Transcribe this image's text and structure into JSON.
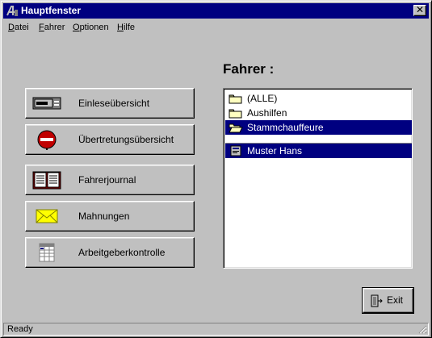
{
  "window": {
    "title": "Hauptfenster",
    "close_glyph": "✕"
  },
  "menu": [
    {
      "label": "Datei",
      "accel": "D",
      "rest": "atei"
    },
    {
      "label": "Fahrer",
      "accel": "F",
      "rest": "ahrer"
    },
    {
      "label": "Optionen",
      "accel": "O",
      "rest": "ptionen"
    },
    {
      "label": "Hilfe",
      "accel": "H",
      "rest": "ilfe"
    }
  ],
  "actions": [
    {
      "label": "Einleseübersicht",
      "icon": "card-reader-icon"
    },
    {
      "label": "Übertretungsübersicht",
      "icon": "no-entry-icon"
    },
    {
      "label": "Fahrerjournal",
      "icon": "open-book-icon"
    },
    {
      "label": "Mahnungen",
      "icon": "envelope-icon"
    },
    {
      "label": "Arbeitgeberkontrolle",
      "icon": "spreadsheet-icon"
    }
  ],
  "drivers": {
    "heading": "Fahrer :",
    "groups": [
      {
        "label": "(ALLE)",
        "icon": "folder-icon",
        "selected": false
      },
      {
        "label": "Aushilfen",
        "icon": "folder-icon",
        "selected": false
      },
      {
        "label": "Stammchauffeure",
        "icon": "open-folder-icon",
        "selected": true
      }
    ],
    "members": [
      {
        "label": "Muster Hans",
        "icon": "driver-card-icon",
        "selected": true
      }
    ]
  },
  "exit": {
    "label": "Exit",
    "icon": "exit-door-icon"
  },
  "status": {
    "text": "Ready"
  },
  "colors": {
    "selection": "#000080",
    "face": "#c0c0c0",
    "title": "#000080"
  }
}
